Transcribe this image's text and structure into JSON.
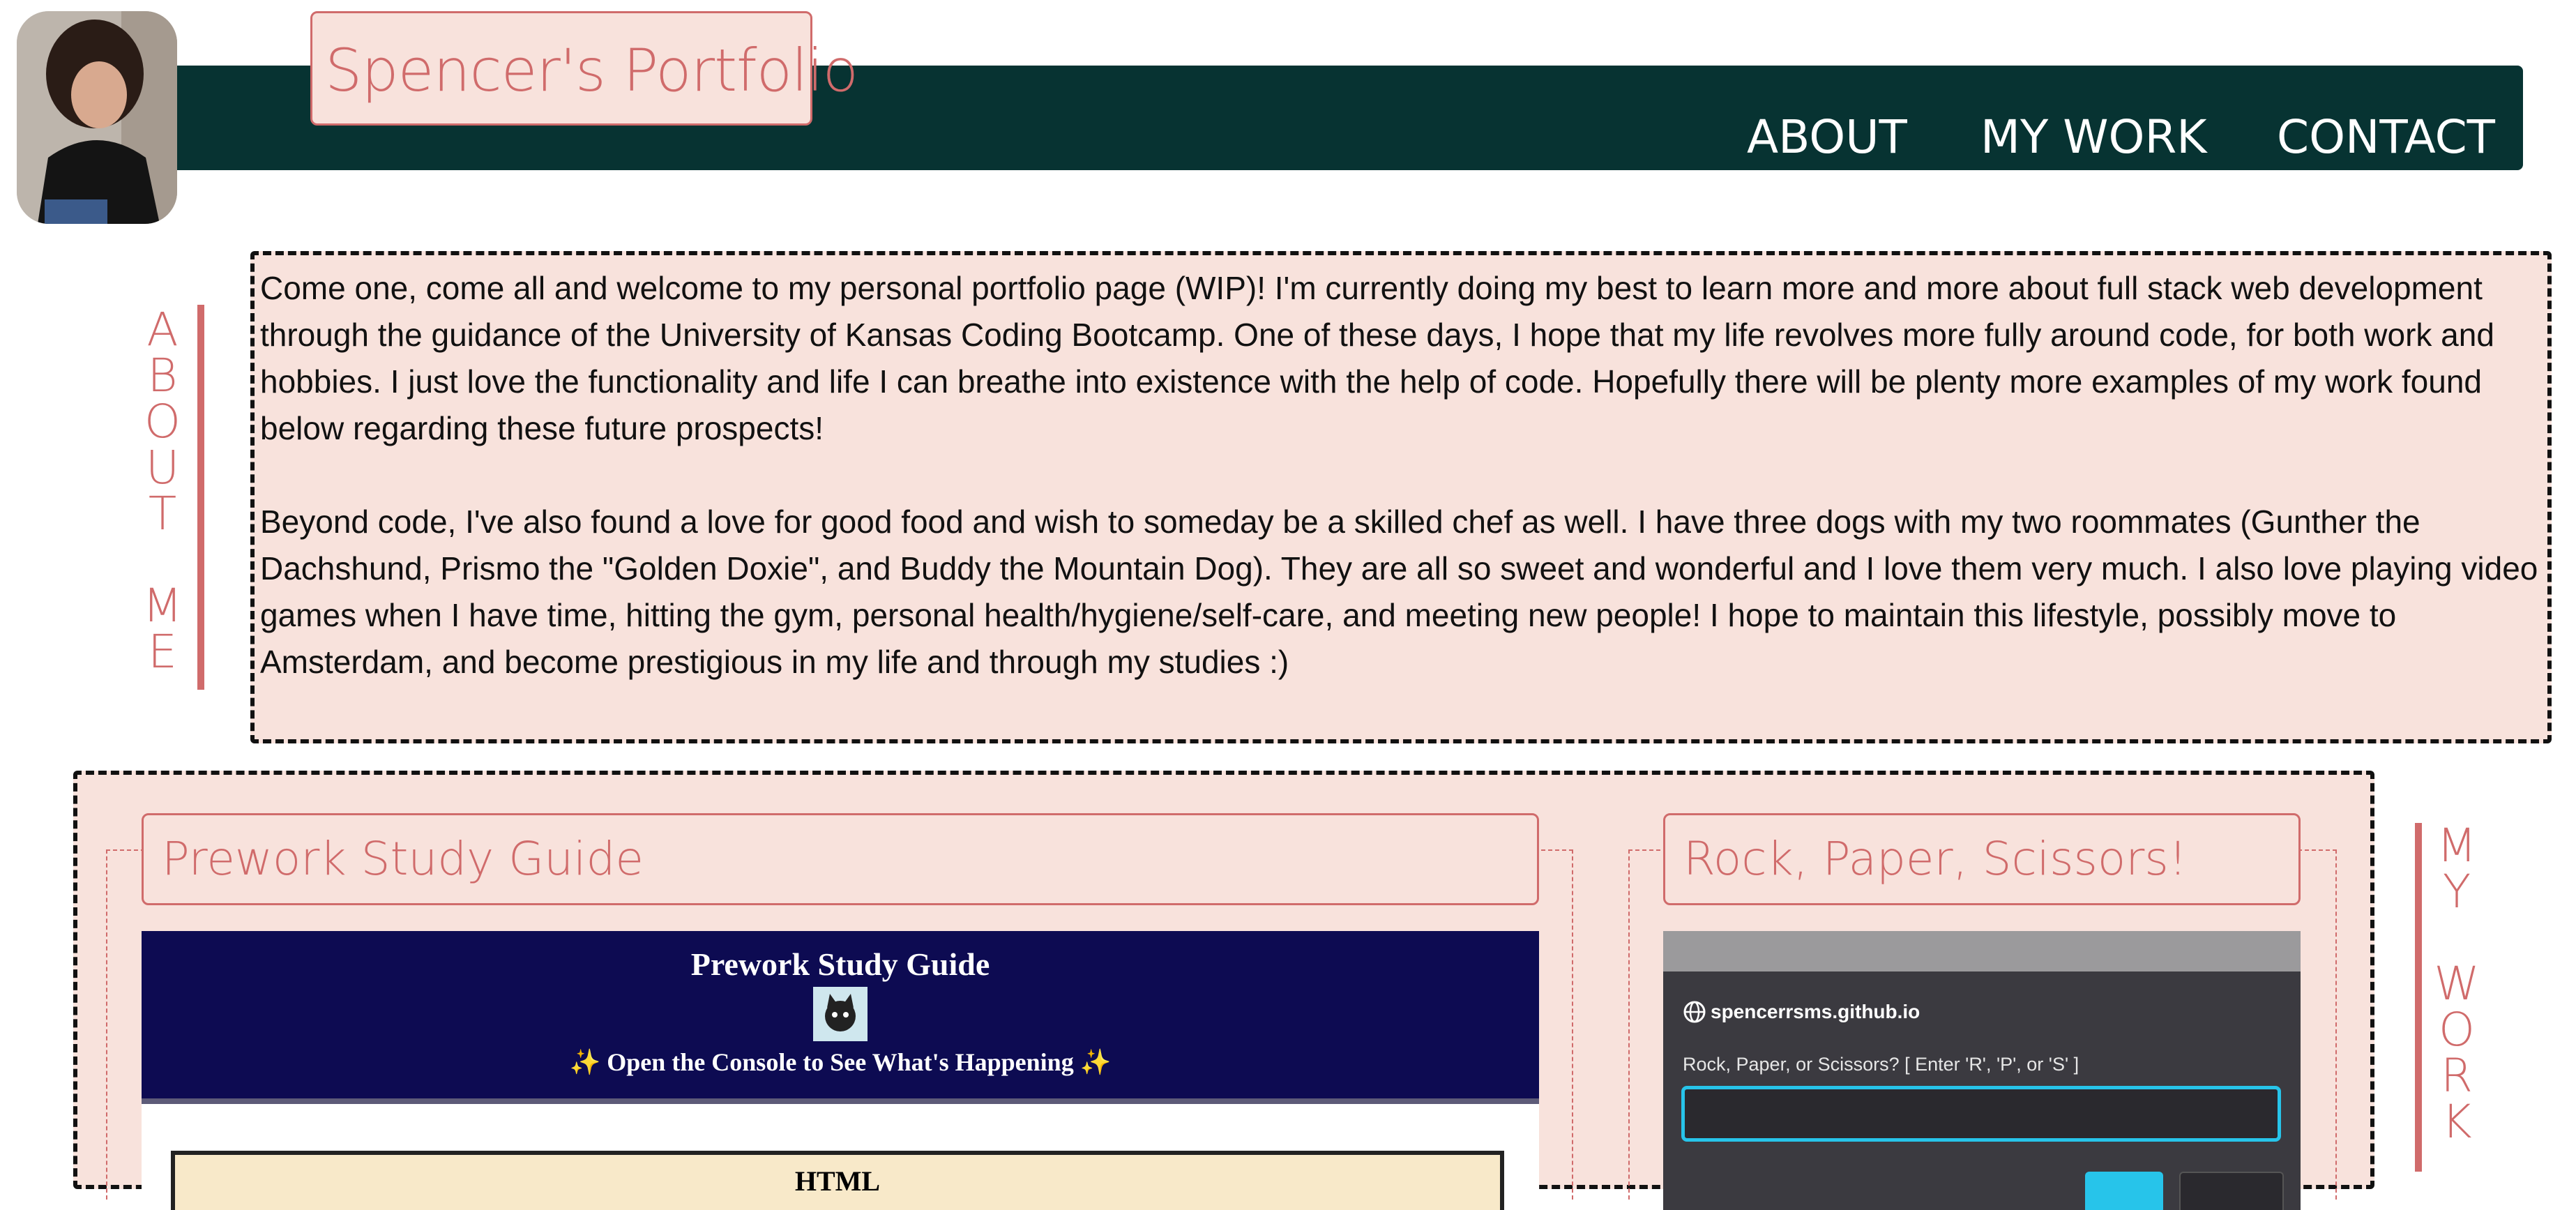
{
  "header": {
    "title": "Spencer's Portfolio",
    "nav": [
      "ABOUT",
      "MY WORK",
      "CONTACT"
    ]
  },
  "about": {
    "label_letters": [
      "A",
      "B",
      "O",
      "U",
      "T",
      "",
      "M",
      "E"
    ],
    "paragraphs": [
      "Come one, come all and welcome to my personal portfolio page (WIP)! I'm currently doing my best to learn more and more about full stack web development through the guidance of the University of Kansas Coding Bootcamp. One of these days, I hope that my life revolves more fully around code, for both work and hobbies. I just love the functionality and life I can breathe into existence with the help of code. Hopefully there will be plenty more examples of my work found below regarding these future prospects!",
      "Beyond code, I've also found a love for good food and wish to someday be a skilled chef as well. I have three dogs with my two roommates (Gunther the Dachshund, Prismo the \"Golden Doxie\", and Buddy the Mountain Dog). They are all so sweet and wonderful and I love them very much. I also love playing video games when I have time, hitting the gym, personal health/hygiene/self-care, and meeting new people! I hope to maintain this lifestyle, possibly move to Amsterdam, and become prestigious in my life and through my studies :)"
    ]
  },
  "work": {
    "label_letters": [
      "M",
      "Y",
      "",
      "W",
      "O",
      "R",
      "K"
    ],
    "projects": [
      {
        "title": "Prework Study Guide",
        "screenshot": {
          "heading": "Prework Study Guide",
          "subtitle": "✨ Open the Console to See What's Happening ✨",
          "section": "HTML"
        }
      },
      {
        "title": "Rock, Paper, Scissors!",
        "screenshot": {
          "domain": "spencerrsms.github.io",
          "prompt": "Rock, Paper, or Scissors? [ Enter 'R', 'P', or 'S' ]"
        }
      }
    ]
  }
}
